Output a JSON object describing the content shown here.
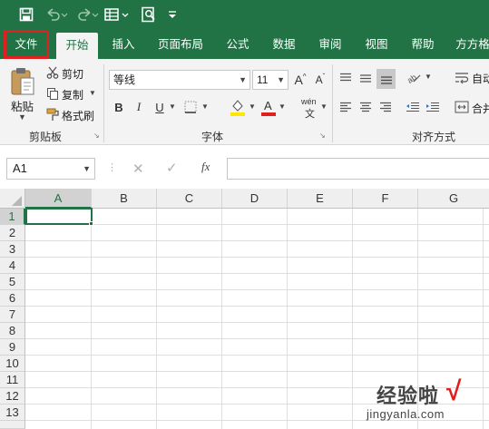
{
  "quick_access": {
    "save_icon": "save-icon",
    "undo_icon": "undo-icon",
    "redo_icon": "redo-icon",
    "form_icon": "form-icon",
    "preview_icon": "print-preview-icon",
    "customize_icon": "customize-icon"
  },
  "tabs": [
    {
      "label": "文件"
    },
    {
      "label": "开始"
    },
    {
      "label": "插入"
    },
    {
      "label": "页面布局"
    },
    {
      "label": "公式"
    },
    {
      "label": "数据"
    },
    {
      "label": "审阅"
    },
    {
      "label": "视图"
    },
    {
      "label": "帮助"
    },
    {
      "label": "方方格"
    }
  ],
  "ribbon": {
    "clipboard": {
      "paste": "粘贴",
      "cut": "剪切",
      "copy": "复制",
      "format_painter": "格式刷",
      "group_label": "剪贴板"
    },
    "font": {
      "font_name": "等线",
      "font_size": "11",
      "grow": "A",
      "shrink": "A",
      "bold": "B",
      "italic": "I",
      "underline": "U",
      "phonetic_top": "wén",
      "phonetic_bottom": "文",
      "group_label": "字体"
    },
    "alignment": {
      "wrap": "自动",
      "merge": "合并",
      "group_label": "对齐方式"
    }
  },
  "formula_bar": {
    "name_box": "A1",
    "fx": "fx",
    "formula": ""
  },
  "grid": {
    "columns": [
      "A",
      "B",
      "C",
      "D",
      "E",
      "F",
      "G"
    ],
    "rows": [
      "1",
      "2",
      "3",
      "4",
      "5",
      "6",
      "7",
      "8",
      "9",
      "10",
      "11",
      "12",
      "13"
    ]
  },
  "watermark": {
    "text": "经验啦",
    "check": "√",
    "url": "jingyanla.com"
  },
  "colors": {
    "accent": "#217346",
    "highlight": "#e02020"
  }
}
